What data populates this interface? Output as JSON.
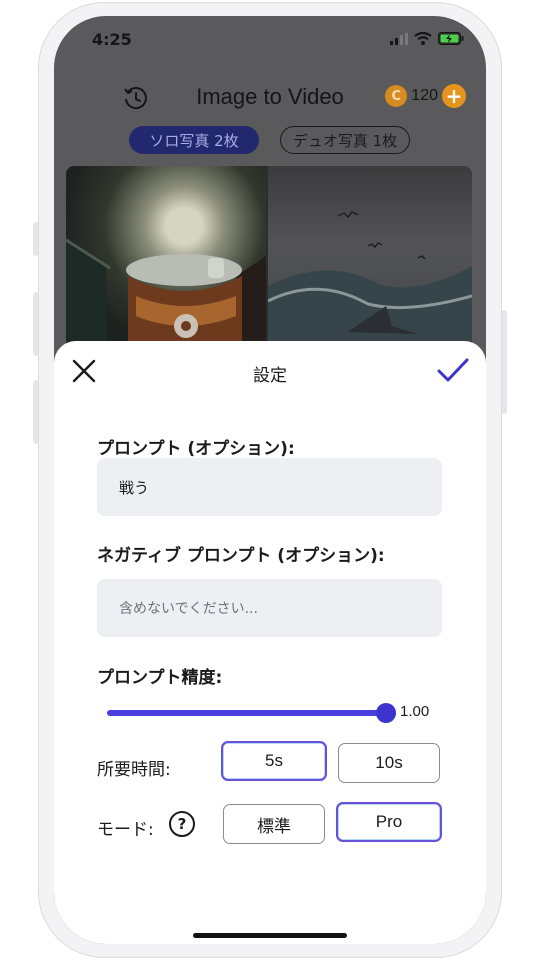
{
  "status_bar": {
    "time": "4:25"
  },
  "header": {
    "title": "Image to Video",
    "coin_symbol": "C",
    "coin_count": "120",
    "add_label": "+"
  },
  "tabs": [
    {
      "label": "ソロ写真 2枚",
      "active": true
    },
    {
      "label": "デュオ写真 1枚",
      "active": false
    }
  ],
  "sheet": {
    "title": "設定",
    "prompt": {
      "label": "プロンプト (オプション):",
      "value": "戦う"
    },
    "negative_prompt": {
      "label": "ネガティブ プロンプト (オプション):",
      "placeholder": "含めないでください..."
    },
    "precision": {
      "label": "プロンプト精度:",
      "value": "1.00",
      "fraction": 1.0
    },
    "duration": {
      "label": "所要時間:",
      "options": [
        "5s",
        "10s"
      ],
      "selected": "5s"
    },
    "mode": {
      "label": "モード:",
      "help": "?",
      "options": [
        "標準",
        "Pro"
      ],
      "selected": "Pro"
    }
  },
  "colors": {
    "accent": "#3c33cf",
    "chip_active_bg": "#22286e",
    "coin": "#e6941c"
  }
}
